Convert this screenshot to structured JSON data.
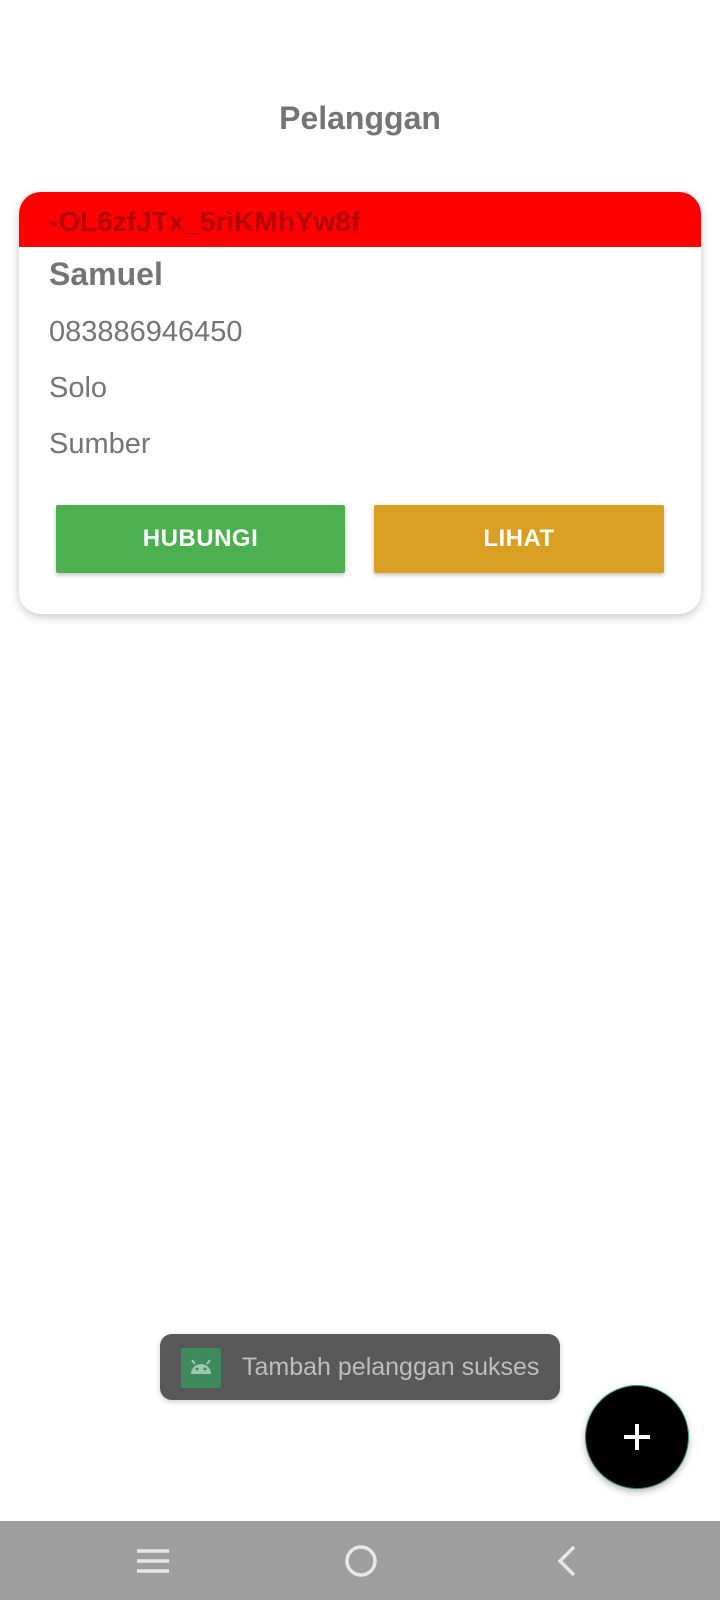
{
  "header": {
    "title": "Pelanggan"
  },
  "customer_card": {
    "id": "-OL6zfJTx_5riKMhYw8f",
    "name": "Samuel",
    "phone": "083886946450",
    "city": "Solo",
    "source": "Sumber",
    "contact_button_label": "HUBUNGI",
    "view_button_label": "LIHAT",
    "header_color": "#ff0000",
    "contact_button_color": "#4caf50",
    "view_button_color": "#daa023"
  },
  "toast": {
    "icon": "android-app-icon",
    "message": "Tambah pelanggan sukses"
  },
  "fab": {
    "icon": "plus-icon"
  },
  "navbar": {
    "items": [
      {
        "icon": "menu-icon"
      },
      {
        "icon": "home-circle-icon"
      },
      {
        "icon": "back-chevron-icon"
      }
    ]
  }
}
